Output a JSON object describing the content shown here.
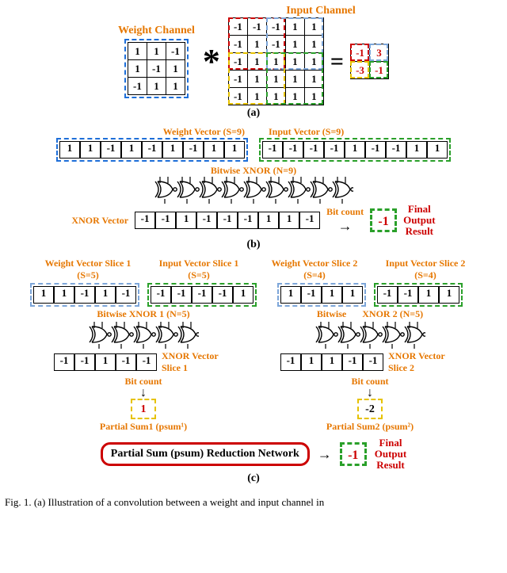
{
  "section_a": {
    "weight_label": "Weight Channel",
    "input_label": "Input Channel",
    "weight_matrix": [
      [
        "1",
        "1",
        "-1"
      ],
      [
        "1",
        "-1",
        "1"
      ],
      [
        "-1",
        "1",
        "1"
      ]
    ],
    "input_matrix": [
      [
        "-1",
        "-1",
        "-1",
        "1",
        "1"
      ],
      [
        "-1",
        "1",
        "-1",
        "1",
        "1"
      ],
      [
        "-1",
        "1",
        "1",
        "1",
        "1"
      ],
      [
        "-1",
        "1",
        "1",
        "1",
        "1"
      ],
      [
        "-1",
        "1",
        "1",
        "1",
        "1"
      ]
    ],
    "op": "*",
    "eq": "=",
    "result_matrix": [
      [
        "-1",
        "3"
      ],
      [
        "-3",
        "-1"
      ]
    ],
    "caption": "(a)"
  },
  "section_b": {
    "weight_label": "Weight Vector (S=9)",
    "input_label": "Input Vector (S=9)",
    "weight_vec": [
      "1",
      "1",
      "-1",
      "1",
      "-1",
      "1",
      "-1",
      "1",
      "1"
    ],
    "input_vec": [
      "-1",
      "-1",
      "-1",
      "-1",
      "1",
      "-1",
      "-1",
      "1",
      "1"
    ],
    "xnor_label": "Bitwise XNOR (N=9)",
    "xnor_vec_label": "XNOR Vector",
    "xnor_vec": [
      "-1",
      "-1",
      "1",
      "-1",
      "-1",
      "-1",
      "1",
      "1",
      "-1"
    ],
    "bitcount_label": "Bit count",
    "final_label_l1": "Final",
    "final_label_l2": "Output",
    "final_label_l3": "Result",
    "result": "-1",
    "caption": "(b)"
  },
  "section_c": {
    "ws1_label": "Weight Vector Slice 1 (S=5)",
    "is1_label": "Input Vector Slice 1 (S=5)",
    "ws2_label": "Weight Vector Slice 2 (S=4)",
    "is2_label": "Input Vector Slice 2 (S=4)",
    "ws1": [
      "1",
      "1",
      "-1",
      "1",
      "-1"
    ],
    "is1": [
      "-1",
      "-1",
      "-1",
      "-1",
      "1"
    ],
    "ws2": [
      "1",
      "-1",
      "1",
      "1"
    ],
    "is2": [
      "-1",
      "-1",
      "1",
      "1"
    ],
    "xnor1_label": "Bitwise XNOR 1 (N=5)",
    "xnor2_label_a": "Bitwise",
    "xnor2_label_b": "XNOR 2 (N=5)",
    "xnor_vec1": [
      "-1",
      "-1",
      "1",
      "-1",
      "-1"
    ],
    "xnor_vec2": [
      "-1",
      "1",
      "1",
      "-1",
      "-1"
    ],
    "xnor_vec_label1": "XNOR Vector Slice 1",
    "xnor_vec_label2": "XNOR Vector Slice 2",
    "bitcount_label": "Bit count",
    "psum1_label": "Partial Sum1 (psum¹)",
    "psum2_label": "Partial Sum2 (psum²)",
    "psum1": "1",
    "psum2": "-2",
    "reduction_label": "Partial Sum (psum) Reduction Network",
    "final_label_l1": "Final",
    "final_label_l2": "Output",
    "final_label_l3": "Result",
    "result": "-1",
    "caption": "(c)"
  },
  "figure_caption": "Fig. 1.  (a) Illustration of a convolution between a weight and input channel in"
}
